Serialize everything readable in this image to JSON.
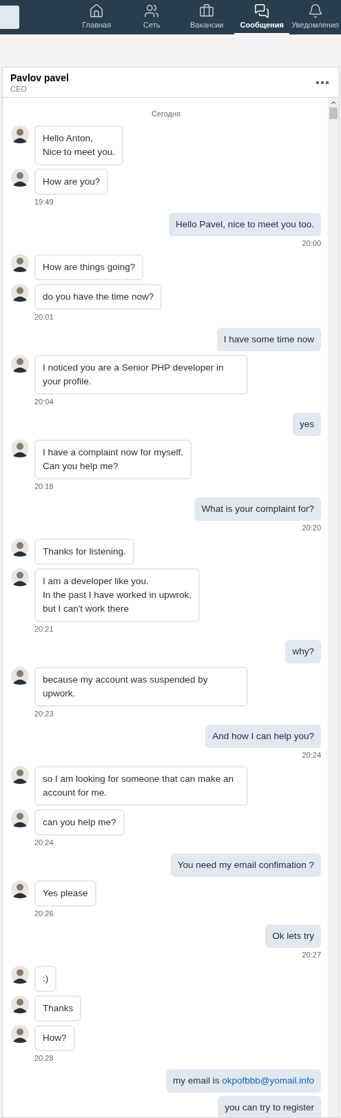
{
  "nav": {
    "items": [
      {
        "label": "Главная",
        "kind": "home",
        "selected": false
      },
      {
        "label": "Сеть",
        "kind": "network",
        "selected": false
      },
      {
        "label": "Вакансии",
        "kind": "jobs",
        "selected": false
      },
      {
        "label": "Сообщения",
        "kind": "messages",
        "selected": true
      },
      {
        "label": "Уведомления",
        "kind": "bell",
        "selected": false
      }
    ]
  },
  "conversation": {
    "name": "Pavlov pavel",
    "title": "CEO"
  },
  "date_divider": "Сегодня",
  "messages": [
    {
      "kind": "in",
      "text": "Hello Anton,\nNice to meet you."
    },
    {
      "kind": "in",
      "text": "How are you?",
      "time": "19:49"
    },
    {
      "kind": "out",
      "text": "Hello Pavel, nice to meet you too.",
      "time": "20:00"
    },
    {
      "kind": "in",
      "text": "How are things going?"
    },
    {
      "kind": "in",
      "text": "do you have the time now?",
      "time": "20:01"
    },
    {
      "kind": "out",
      "text": "I have some time now"
    },
    {
      "kind": "in",
      "text": "I noticed you are a Senior PHP developer in your profile.",
      "time": "20:04"
    },
    {
      "kind": "out",
      "text": "yes"
    },
    {
      "kind": "in",
      "text": "I have a complaint now for myself.\nCan you help me?",
      "time": "20:18"
    },
    {
      "kind": "out",
      "text": "What is your complaint for?",
      "time": "20:20"
    },
    {
      "kind": "in",
      "text": "Thanks for listening."
    },
    {
      "kind": "in",
      "text": "I am a developer like you.\nIn the past I have worked in upwrok.\nbut I can't work there",
      "time": "20:21"
    },
    {
      "kind": "out",
      "text": "why?"
    },
    {
      "kind": "in",
      "text": "because my account was suspended by upwork.",
      "time": "20:23"
    },
    {
      "kind": "out",
      "text": "And how I can help you?",
      "time": "20:24"
    },
    {
      "kind": "in",
      "text": "so I am looking for someone that can make an account for me."
    },
    {
      "kind": "in",
      "text": "can you help me?",
      "time": "20:24"
    },
    {
      "kind": "out",
      "text": "You need my email confimation ?"
    },
    {
      "kind": "in",
      "text": "Yes please",
      "time": "20:26"
    },
    {
      "kind": "out",
      "text": "Ok lets try",
      "time": "20:27"
    },
    {
      "kind": "in",
      "text": ":)"
    },
    {
      "kind": "in",
      "text": "Thanks"
    },
    {
      "kind": "in",
      "text": "How?",
      "time": "20:28"
    },
    {
      "kind": "out",
      "text": "my email is ",
      "link": "okpofbbb@yomail.info"
    },
    {
      "kind": "out",
      "text": "you can try to register"
    }
  ]
}
